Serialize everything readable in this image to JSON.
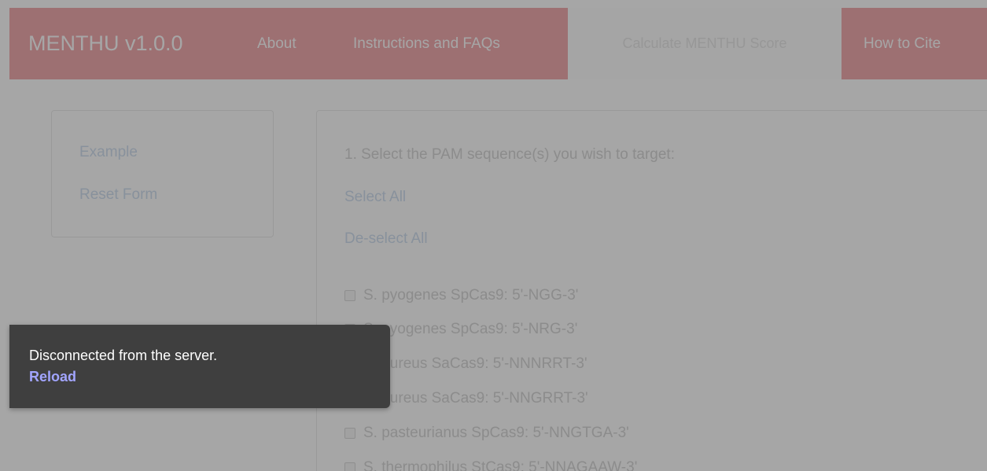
{
  "navbar": {
    "brand": "MENTHU v1.0.0",
    "about": "About",
    "instructions": "Instructions and FAQs",
    "active": "Calculate MENTHU Score",
    "cite": "How to Cite"
  },
  "sidebar": {
    "example": "Example",
    "reset": "Reset Form"
  },
  "main": {
    "step_title": "1. Select the PAM sequence(s) you wish to target:",
    "select_all": "Select All",
    "deselect_all": "De-select All",
    "pam_options": [
      "S. pyogenes SpCas9: 5'-NGG-3'",
      "S. pyogenes SpCas9: 5'-NRG-3'",
      "S. aureus SaCas9: 5'-NNNRRT-3'",
      "S. aureus SaCas9: 5'-NNGRRT-3'",
      "S. pasteurianus SpCas9: 5'-NNGTGA-3'",
      "S. thermophilus StCas9: 5'-NNAGAAW-3'"
    ]
  },
  "toast": {
    "message": "Disconnected from the server.",
    "reload": "Reload"
  },
  "colors": {
    "navbar": "#f2acb0",
    "toast_bg": "#3f3f3f",
    "reload_link": "#a2a5ff",
    "overlay": "rgba(0,0,0,0.35)"
  }
}
